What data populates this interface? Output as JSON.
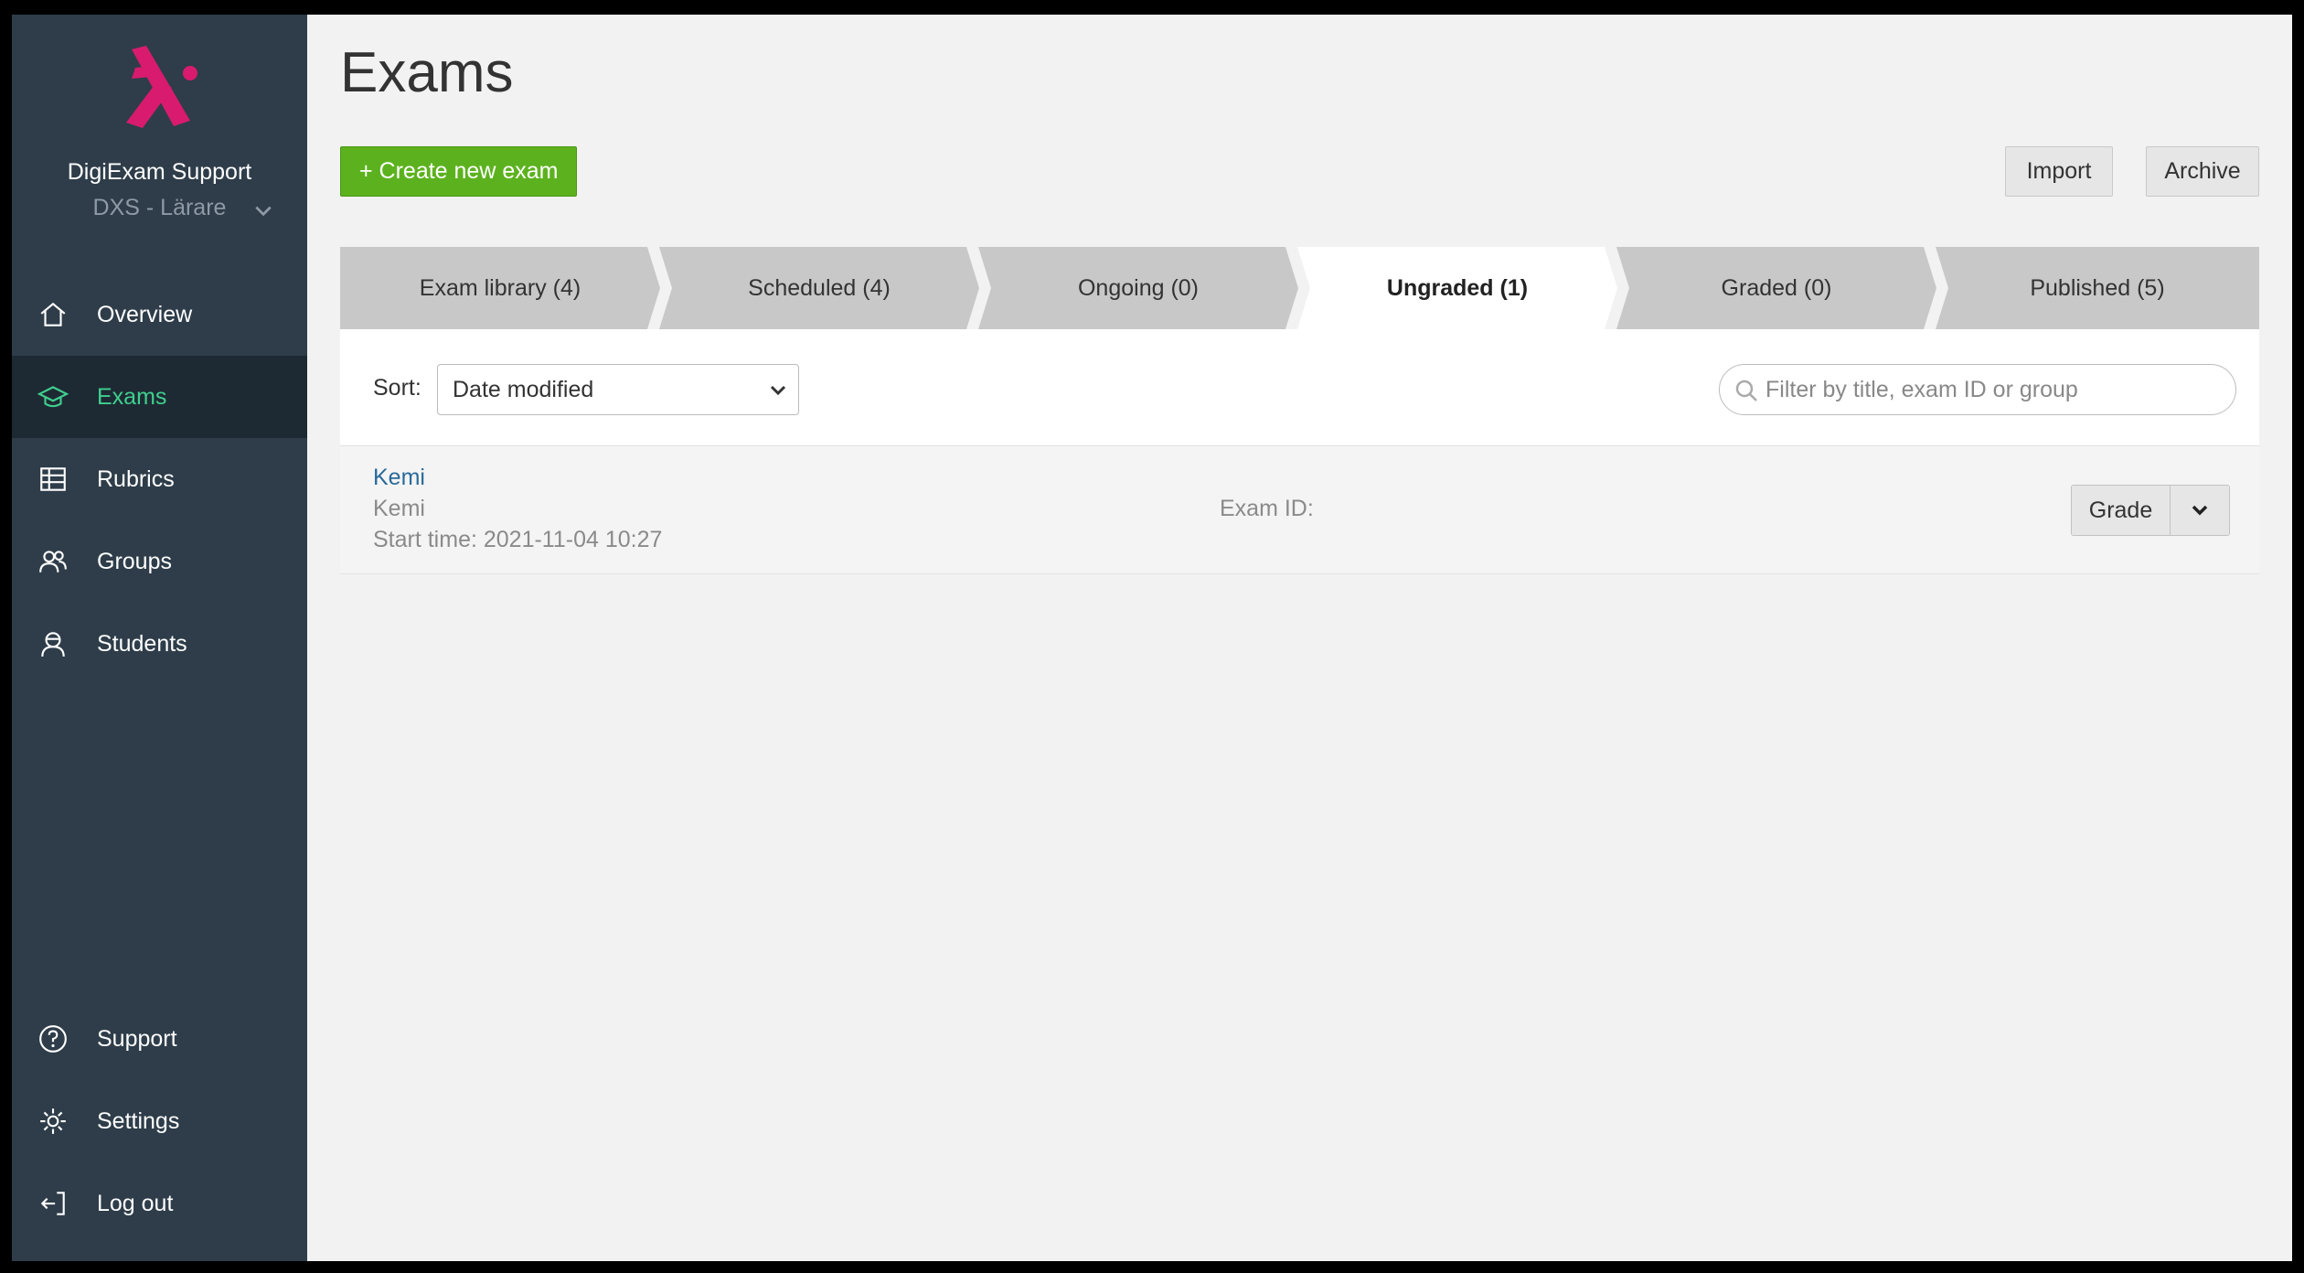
{
  "sidebar": {
    "org_name": "DigiExam Support",
    "org_role": "DXS - Lärare",
    "nav": [
      {
        "label": "Overview",
        "icon": "home-icon"
      },
      {
        "label": "Exams",
        "icon": "graduation-cap-icon",
        "active": true
      },
      {
        "label": "Rubrics",
        "icon": "table-icon"
      },
      {
        "label": "Groups",
        "icon": "users-icon"
      },
      {
        "label": "Students",
        "icon": "student-icon"
      }
    ],
    "bottom_nav": [
      {
        "label": "Support",
        "icon": "help-circle-icon"
      },
      {
        "label": "Settings",
        "icon": "gear-icon"
      },
      {
        "label": "Log out",
        "icon": "logout-icon"
      }
    ]
  },
  "header": {
    "title": "Exams",
    "create_label": "+ Create new exam",
    "import_label": "Import",
    "archive_label": "Archive"
  },
  "tabs": [
    {
      "label": "Exam library (4)"
    },
    {
      "label": "Scheduled (4)"
    },
    {
      "label": "Ongoing (0)"
    },
    {
      "label": "Ungraded (1)",
      "active": true
    },
    {
      "label": "Graded (0)"
    },
    {
      "label": "Published (5)"
    }
  ],
  "toolbar": {
    "sort_label": "Sort:",
    "sort_value": "Date modified",
    "filter_placeholder": "Filter by title, exam ID or group"
  },
  "exams": [
    {
      "title": "Kemi",
      "subject": "Kemi",
      "start_time": "Start time: 2021-11-04 10:27",
      "exam_id": "Exam ID: ",
      "grade_label": "Grade"
    }
  ],
  "colors": {
    "sidebar_bg": "#2e3d49",
    "sidebar_active_bg": "#1e2a33",
    "active_text": "#3fcf8e",
    "create_button": "#5cb21e",
    "logo": "#d81b6e",
    "link": "#2a6a9a"
  }
}
